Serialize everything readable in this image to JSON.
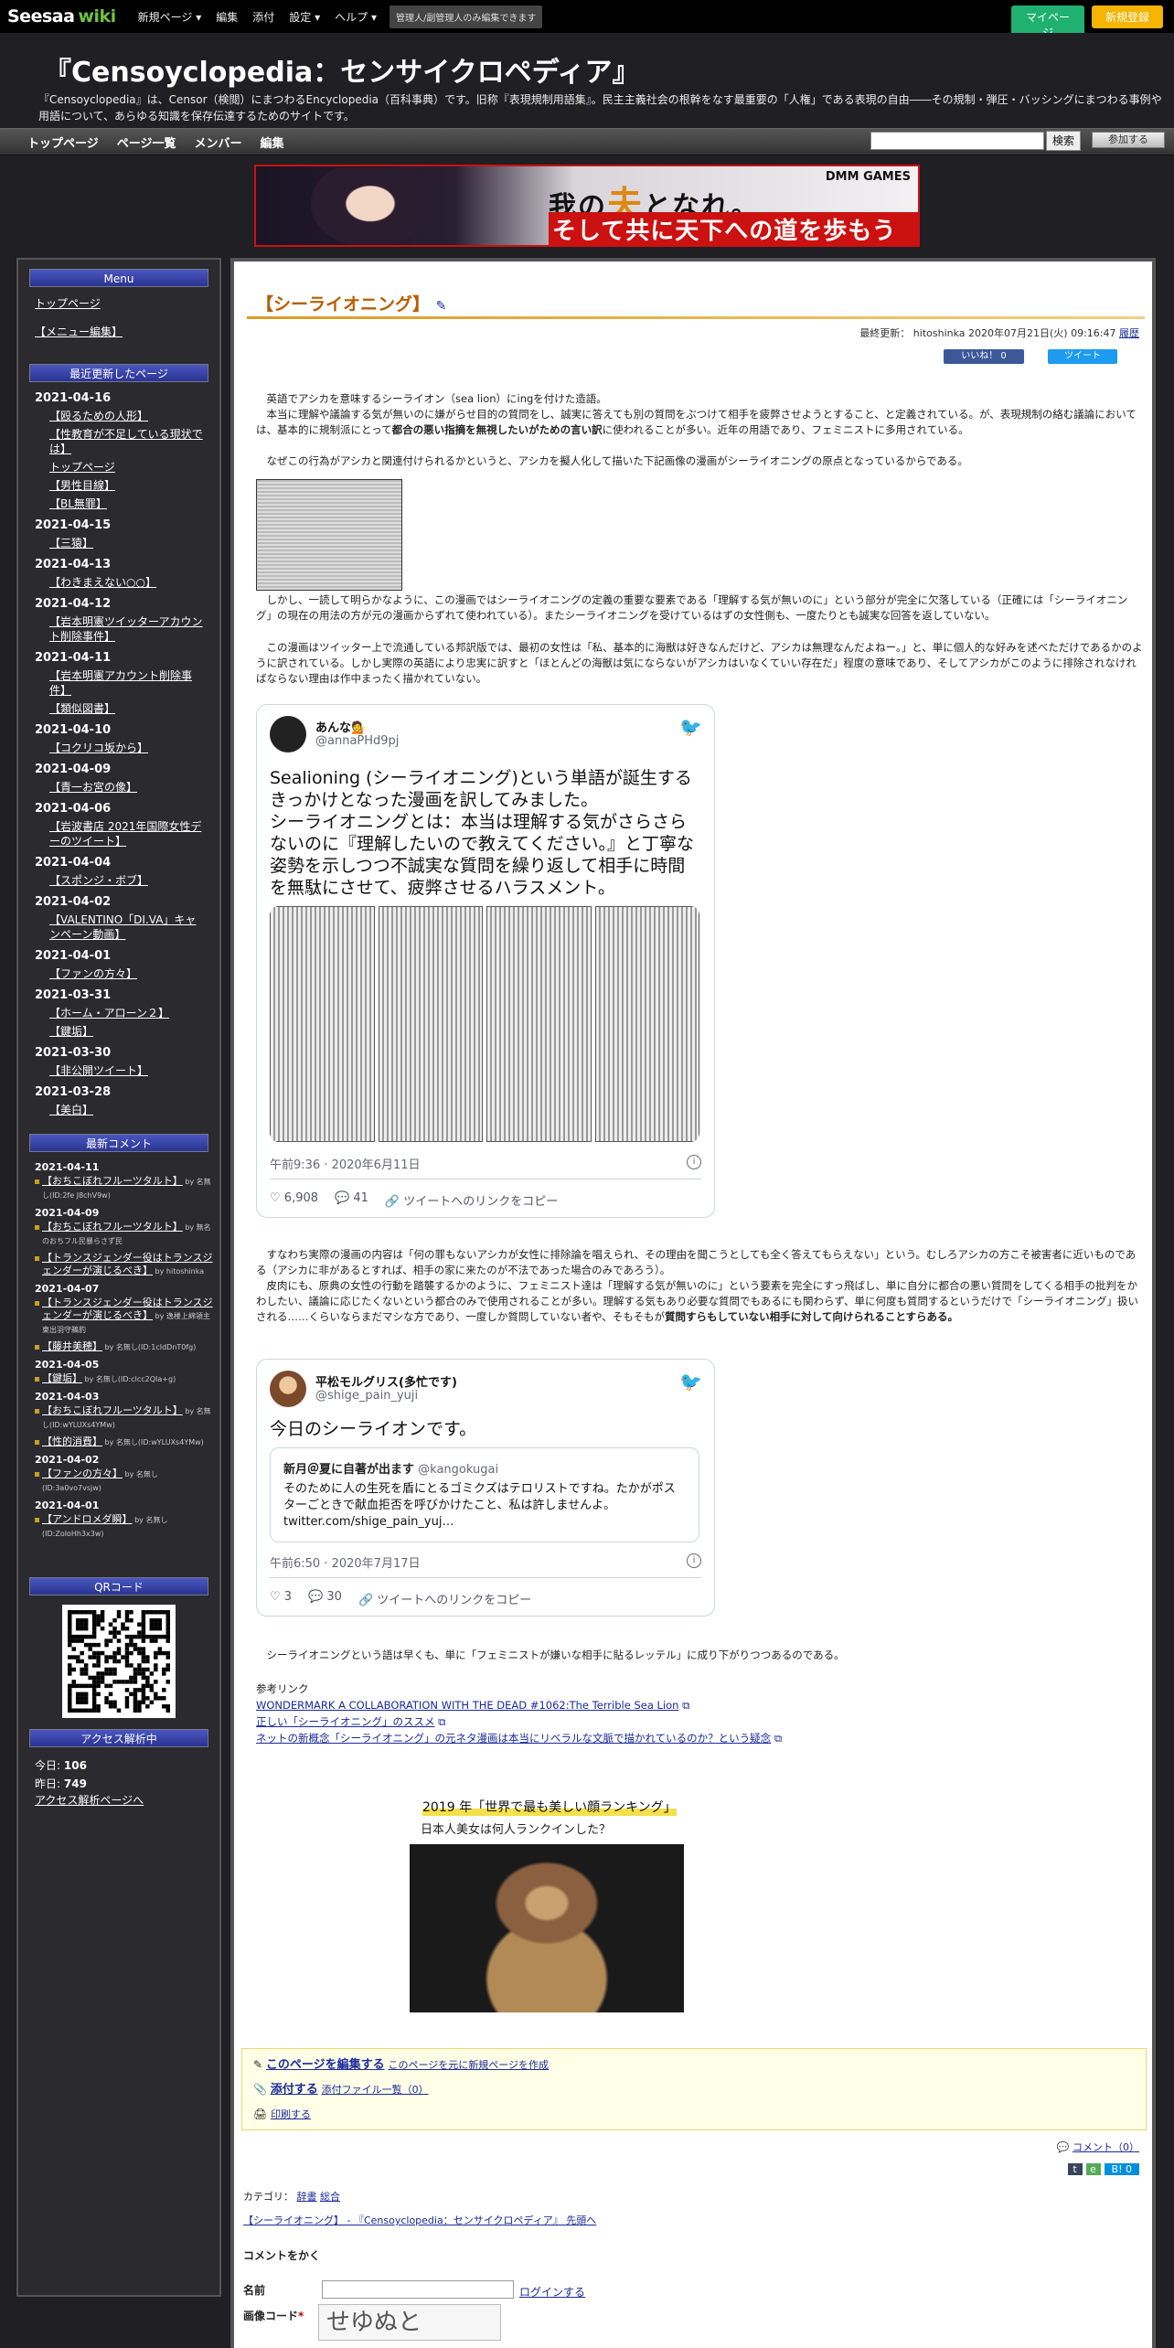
{
  "topbar": {
    "logo": "Seesaa",
    "logo_wiki": "wiki",
    "menu": [
      "新規ページ ▾",
      "編集",
      "添付",
      "設定 ▾",
      "ヘルプ ▾"
    ],
    "notice": "管理人/副管理人のみ編集できます",
    "mypage": "マイページ",
    "signup": "新規登録"
  },
  "header": {
    "title": "『Censoyclopedia：センサイクロペディア』",
    "desc": "『Censoyclopedia』は、Censor（検閲）にまつわるEncyclopedia（百科事典）です。旧称『表現規制用語集』。民主主義社会の根幹をなす最重要の「人権」である表現の自由――その規制・弾圧・バッシングにまつわる事例や用語について、あらゆる知識を保存伝達するためのサイトです。"
  },
  "nav": {
    "items": [
      "トップページ",
      "ページ一覧",
      "メンバー",
      "編集"
    ],
    "search_button": "検索",
    "join": "参加する"
  },
  "banner": {
    "line1_a": "我の",
    "line1_b": "夫",
    "line1_c": "となれ。",
    "line2": "そして共に天下への道を歩もうぞ！",
    "brand": "DMM GAMES"
  },
  "sidebar": {
    "menu_title": "Menu",
    "menu_links": [
      "トップページ",
      "【メニュー編集】"
    ],
    "recent_title": "最近更新したページ",
    "recent": [
      {
        "date": "2021-04-16",
        "items": [
          "【殴るための人形】",
          "【性教育が不足している現状では】",
          "トップページ",
          "【男性目線】",
          "【BL無罪】"
        ]
      },
      {
        "date": "2021-04-15",
        "items": [
          "【三猿】"
        ]
      },
      {
        "date": "2021-04-13",
        "items": [
          "【わきまえない○○】"
        ]
      },
      {
        "date": "2021-04-12",
        "items": [
          "【岩本明憲ツイッターアカウント削除事件】"
        ]
      },
      {
        "date": "2021-04-11",
        "items": [
          "【岩本明憲アカウント削除事件】",
          "【類似図書】"
        ]
      },
      {
        "date": "2021-04-10",
        "items": [
          "【コクリコ坂から】"
        ]
      },
      {
        "date": "2021-04-09",
        "items": [
          "【青一お宮の像】"
        ]
      },
      {
        "date": "2021-04-06",
        "items": [
          "【岩波書店 2021年国際女性デーのツイート】"
        ]
      },
      {
        "date": "2021-04-04",
        "items": [
          "【スポンジ・ボブ】"
        ]
      },
      {
        "date": "2021-04-02",
        "items": [
          "【VALENTINO「DI.VA」キャンペーン動画】"
        ]
      },
      {
        "date": "2021-04-01",
        "items": [
          "【ファンの方々】"
        ]
      },
      {
        "date": "2021-03-31",
        "items": [
          "【ホーム・アローン２】",
          "【鍵垢】"
        ]
      },
      {
        "date": "2021-03-30",
        "items": [
          "【非公開ツイート】"
        ]
      },
      {
        "date": "2021-03-28",
        "items": [
          "【美白】"
        ]
      }
    ],
    "comments_title": "最新コメント",
    "comments": [
      {
        "date": "2021-04-11",
        "items": [
          {
            "t": "【おちこぼれフルーツタルト】",
            "by": "by 名無し(ID:2fe J8chV9w)"
          }
        ]
      },
      {
        "date": "2021-04-09",
        "items": [
          {
            "t": "【おちこぼれフルーツタルト】",
            "by": "by 無名のおちフル民暴らさず民"
          },
          {
            "t": "【トランスジェンダー役はトランスジェンダーが演じるべき】",
            "by": "by hitoshinka"
          }
        ]
      },
      {
        "date": "2021-04-07",
        "items": [
          {
            "t": "【トランスジェンダー役はトランスジェンダーが演じるべき】",
            "by": "by 逸楼上綿領主　東出羽守鵜豹"
          },
          {
            "t": "【藤井美穂】",
            "by": "by 名無し(ID:1cIdDnT0fg)"
          }
        ]
      },
      {
        "date": "2021-04-05",
        "items": [
          {
            "t": "【鍵垢】",
            "by": "by 名無し(ID:clcc2QIa+g)"
          }
        ]
      },
      {
        "date": "2021-04-03",
        "items": [
          {
            "t": "【おちこぼれフルーツタルト】",
            "by": "by 名無し(ID:wYLUXs4YMw)"
          },
          {
            "t": "【性的消費】",
            "by": "by 名無し(ID:wYLUXs4YMw)"
          }
        ]
      },
      {
        "date": "2021-04-02",
        "items": [
          {
            "t": "【ファンの方々】",
            "by": "by 名無し(ID:3a0vo7vsjw)"
          }
        ]
      },
      {
        "date": "2021-04-01",
        "items": [
          {
            "t": "【アンドロメダ瞬】",
            "by": "by 名無し(ID:ZoloHh3x3w)"
          }
        ]
      }
    ],
    "qr_title": "QRコード",
    "access_title": "アクセス解析中",
    "today_label": "今日:",
    "today": "106",
    "yesterday_label": "昨日:",
    "yesterday": "749",
    "access_link": "アクセス解析ページへ"
  },
  "page": {
    "title": "【シーライオニング】",
    "meta": "最終更新： hitoshinka 2020年07月21日(火) 09:16:47",
    "history": "履歴",
    "like": "いいね！ 0",
    "tweet": "ツイート",
    "p1": "　英語でアシカを意味するシーライオン（sea lion）にingを付けた造語。",
    "p2a": "　本当に理解や議論する気が無いのに嫌がらせ目的の質問をし、誠実に答えても別の質問をぶつけて相手を疲弊させようとすること、と定義されている。が、表現規制の絡む議論においては、基本的に規制派にとって",
    "p2b": "都合の悪い指摘を無視したいがための言い訳",
    "p2c": "に使われることが多い。近年の用語であり、フェミニストに多用されている。",
    "p3": "　なぜこの行為がアシカと関連付けられるかというと、アシカを擬人化して描いた下記画像の漫画がシーライオニングの原点となっているからである。",
    "p4": "　しかし、一読して明らかなように、この漫画ではシーライオニングの定義の重要な要素である「理解する気が無いのに」という部分が完全に欠落している（正確には「シーライオニング」の現在の用法の方が元の漫画からずれて使われている）。またシーライオニングを受けているはずの女性側も、一度たりとも誠実な回答を返していない。",
    "p5": "　この漫画はツイッター上で流通している邦訳版では、最初の女性は「私、基本的に海獣は好きなんだけど、アシカは無理なんだよねー。」と、単に個人的な好みを述べただけであるかのように訳されている。しかし実際の英語により忠実に訳すと「ほとんどの海獣は気にならないがアシカはいなくていい存在だ」程度の意味であり、そしてアシカがこのように排除されなければならない理由は作中まったく描かれていない。",
    "tweet1": {
      "name": "あんな💁",
      "handle": "@annaPHd9pj",
      "text": "Sealioning (シーライオニング)という単語が誕生するきっかけとなった漫画を訳してみました。\nシーライオニングとは：本当は理解する気がさらさらないのに『理解したいので教えてください。』と丁寧な姿勢を示しつつ不誠実な質問を繰り返して相手に時間を無駄にさせて、疲弊させるハラスメント。",
      "date": "午前9:36 · 2020年6月11日",
      "likes": "6,908",
      "replies": "41",
      "copy": "ツイートへのリンクをコピー"
    },
    "p6": "　すなわち実際の漫画の内容は「何の罪もないアシカが女性に排除論を唱えられ、その理由を聞こうとしても全く答えてもらえない」という。むしろアシカの方こそ被害者に近いものである（アシカに非があるとすれば、相手の家に来たのが不法であった場合のみであろう）。",
    "p7a": "　皮肉にも、原典の女性の行動を踏襲するかのように、フェミニスト達は「理解する気が無いのに」という要素を完全にすっ飛ばし、単に自分に都合の悪い質問をしてくる相手の批判をかわしたい、議論に応じたくないという都合のみで使用されることが多い。理解する気もあり必要な質問でもあるにも関わらず、単に何度も質問するというだけで「シーライオニング」扱いされる……くらいならまだマシな方であり、一度しか質問していない者や、そもそもが",
    "p7b": "質問すらもしていない相手に対して向けられることすらある。",
    "tweet2": {
      "name": "平松モルグリス(多忙です)",
      "handle": "@shige_pain_yuji",
      "text": "今日のシーライオンです。",
      "quote_name": "新月＠夏に自著が出ます",
      "quote_handle": "@kangokugai",
      "quote_text": "そのために人の生死を盾にとるゴミクズはテロリストですね。たかがポスターごときで献血拒否を呼びかけたこと、私は許しませんよ。 twitter.com/shige_pain_yuj…",
      "date": "午前6:50 · 2020年7月17日",
      "likes": "3",
      "replies": "30",
      "copy": "ツイートへのリンクをコピー"
    },
    "p8": "　シーライオニングという語は早くも、単に「フェミニストが嫌いな相手に貼るレッテル」に成り下がりつつあるのである。",
    "ref_title": "参考リンク",
    "refs": [
      "WONDERMARK A COLLABORATION WITH THE DEAD #1062:The Terrible Sea Lion",
      "正しい「シーライオニング」のススメ",
      "ネットの新概念「シーライオニング」の元ネタ漫画は本当にリベラルな文脈で描かれているのか？という疑念"
    ],
    "ad_title": "2019 年「世界で最も美しい顔ランキング」",
    "ad_sub": "日本人美女は何人ランクインした？",
    "tool_edit": "このページを編集する",
    "tool_new": "このページを元に新規ページを作成",
    "tool_attach": "添付する",
    "tool_attach_list": "添付ファイル一覧（0）",
    "tool_print": "印刷する",
    "comments_link": "コメント（0）",
    "bookmark": "B! 0",
    "category_label": "カテゴリ：",
    "categories": [
      "辞書",
      "総合"
    ],
    "crumb": "【シーライオニング】 - 『Censoyclopedia：センサイクロペディア』 先頭へ",
    "comment_heading": "コメントをかく",
    "name_label": "名前",
    "login": "ログインする",
    "captcha_label": "画像コード",
    "captcha_text": "せゆぬと"
  }
}
